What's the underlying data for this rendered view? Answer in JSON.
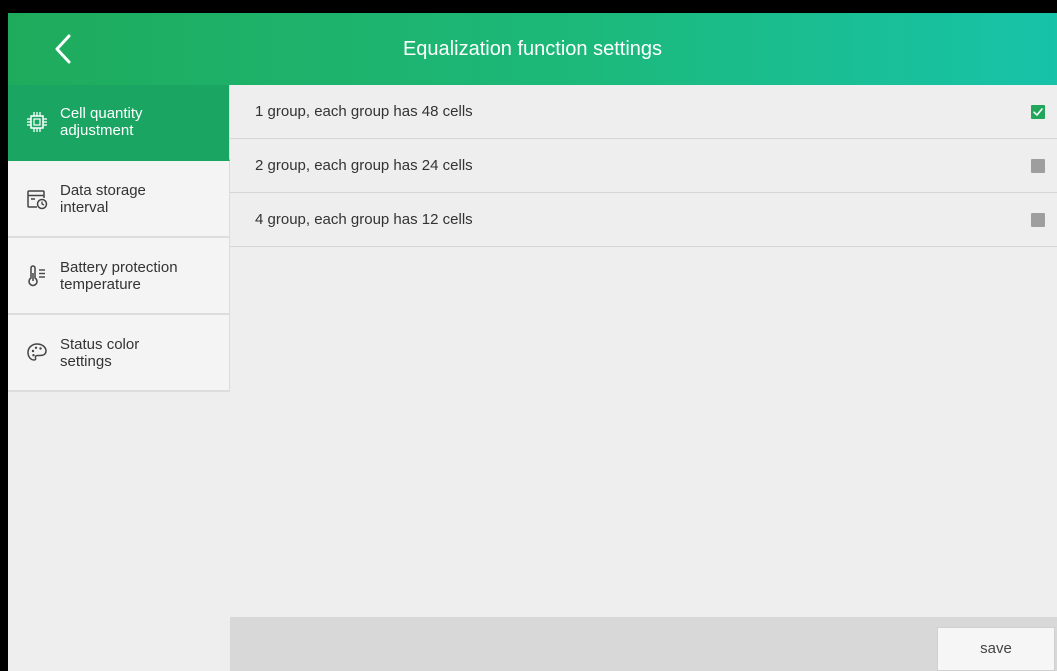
{
  "header": {
    "title": "Equalization function settings",
    "back_icon": "chevron-left-icon"
  },
  "sidebar": {
    "items": [
      {
        "label_line1": "Cell quantity",
        "label_line2": "adjustment",
        "icon": "chip-icon",
        "active": true
      },
      {
        "label_line1": "Data storage",
        "label_line2": "interval",
        "icon": "calendar-clock-icon",
        "active": false
      },
      {
        "label_line1": "Battery protection",
        "label_line2": "temperature",
        "icon": "thermometer-icon",
        "active": false
      },
      {
        "label_line1": "Status color",
        "label_line2": "settings",
        "icon": "palette-icon",
        "active": false
      }
    ]
  },
  "options": [
    {
      "label": "1 group, each group has 48 cells",
      "checked": true
    },
    {
      "label": "2 group, each group has 24 cells",
      "checked": false
    },
    {
      "label": "4 group, each group has 12 cells",
      "checked": false
    }
  ],
  "footer": {
    "save_label": "save"
  },
  "colors": {
    "accent": "#1aa562",
    "header_gradient_start": "#1fab5c",
    "header_gradient_end": "#17c3a9",
    "checkbox_checked": "#21a65b",
    "checkbox_unchecked": "#9e9e9e"
  }
}
